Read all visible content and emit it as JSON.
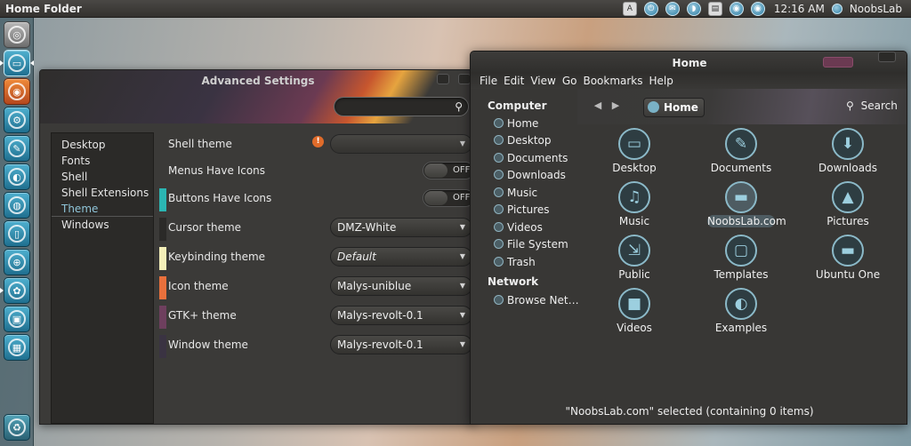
{
  "panel": {
    "title": "Home Folder",
    "clock": "12:16 AM",
    "user": "NoobsLab",
    "tray_icons": [
      "ad-icon",
      "power-icon",
      "mail-icon",
      "chat-icon",
      "clipboard-icon",
      "network-icon",
      "volume-icon",
      "session-icon"
    ]
  },
  "launcher": {
    "items": [
      "ubuntu-icon",
      "files-icon",
      "firefox-icon",
      "app-icon",
      "app-icon",
      "app-icon",
      "app-icon",
      "app-icon",
      "app-icon",
      "app-icon",
      "app-icon",
      "workspaces-icon",
      "trash-icon"
    ]
  },
  "advanced_settings": {
    "title": "Advanced Settings",
    "sidebar": [
      {
        "label": "Desktop",
        "active": false
      },
      {
        "label": "Fonts",
        "active": false
      },
      {
        "label": "Shell",
        "active": false
      },
      {
        "label": "Shell Extensions",
        "active": false
      },
      {
        "label": "Theme",
        "active": true
      },
      {
        "label": "Windows",
        "active": false
      }
    ],
    "rows": [
      {
        "label": "Shell theme",
        "control": "combo",
        "value": "",
        "swatch": "",
        "warning": true
      },
      {
        "label": "Menus Have Icons",
        "control": "toggle",
        "value": "OFF",
        "swatch": ""
      },
      {
        "label": "Buttons Have Icons",
        "control": "toggle",
        "value": "OFF",
        "swatch": "#2bb5b2"
      },
      {
        "label": "Cursor theme",
        "control": "combo",
        "value": "DMZ-White",
        "swatch": "#2b2a28"
      },
      {
        "label": "Keybinding theme",
        "control": "combo",
        "value": "Default",
        "swatch": "#f4efb8",
        "italic": true
      },
      {
        "label": "Icon theme",
        "control": "combo",
        "value": "Malys-uniblue",
        "swatch": "#e9703c"
      },
      {
        "label": "GTK+ theme",
        "control": "combo",
        "value": "Malys-revolt-0.1",
        "swatch": "#6e3f5e"
      },
      {
        "label": "Window theme",
        "control": "combo",
        "value": "Malys-revolt-0.1",
        "swatch": "#3a3342"
      }
    ]
  },
  "home_folder": {
    "title": "Home",
    "menu": [
      "File",
      "Edit",
      "View",
      "Go",
      "Bookmarks",
      "Help"
    ],
    "breadcrumb": "Home",
    "search_label": "Search",
    "sidebar": {
      "computer_header": "Computer",
      "computer_items": [
        "Home",
        "Desktop",
        "Documents",
        "Downloads",
        "Music",
        "Pictures",
        "Videos",
        "File System",
        "Trash"
      ],
      "network_header": "Network",
      "network_items": [
        "Browse Net…"
      ]
    },
    "files": [
      {
        "name": "Desktop",
        "icon": "desktop-icon",
        "glyph": "▭",
        "selected": false
      },
      {
        "name": "Documents",
        "icon": "documents-icon",
        "glyph": "✎",
        "selected": false
      },
      {
        "name": "Downloads",
        "icon": "downloads-icon",
        "glyph": "⬇",
        "selected": false
      },
      {
        "name": "Music",
        "icon": "music-icon",
        "glyph": "♫",
        "selected": false
      },
      {
        "name": "NoobsLab.com",
        "icon": "folder-icon",
        "glyph": "▬",
        "selected": true
      },
      {
        "name": "Pictures",
        "icon": "pictures-icon",
        "glyph": "▲",
        "selected": false
      },
      {
        "name": "Public",
        "icon": "public-icon",
        "glyph": "⇲",
        "selected": false
      },
      {
        "name": "Templates",
        "icon": "templates-icon",
        "glyph": "▢",
        "selected": false
      },
      {
        "name": "Ubuntu One",
        "icon": "ubuntu-one-icon",
        "glyph": "▬",
        "selected": false
      },
      {
        "name": "Videos",
        "icon": "videos-icon",
        "glyph": "■",
        "selected": false
      },
      {
        "name": "Examples",
        "icon": "examples-icon",
        "glyph": "◐",
        "selected": false
      }
    ],
    "status": "\"NoobsLab.com\" selected (containing 0 items)"
  }
}
